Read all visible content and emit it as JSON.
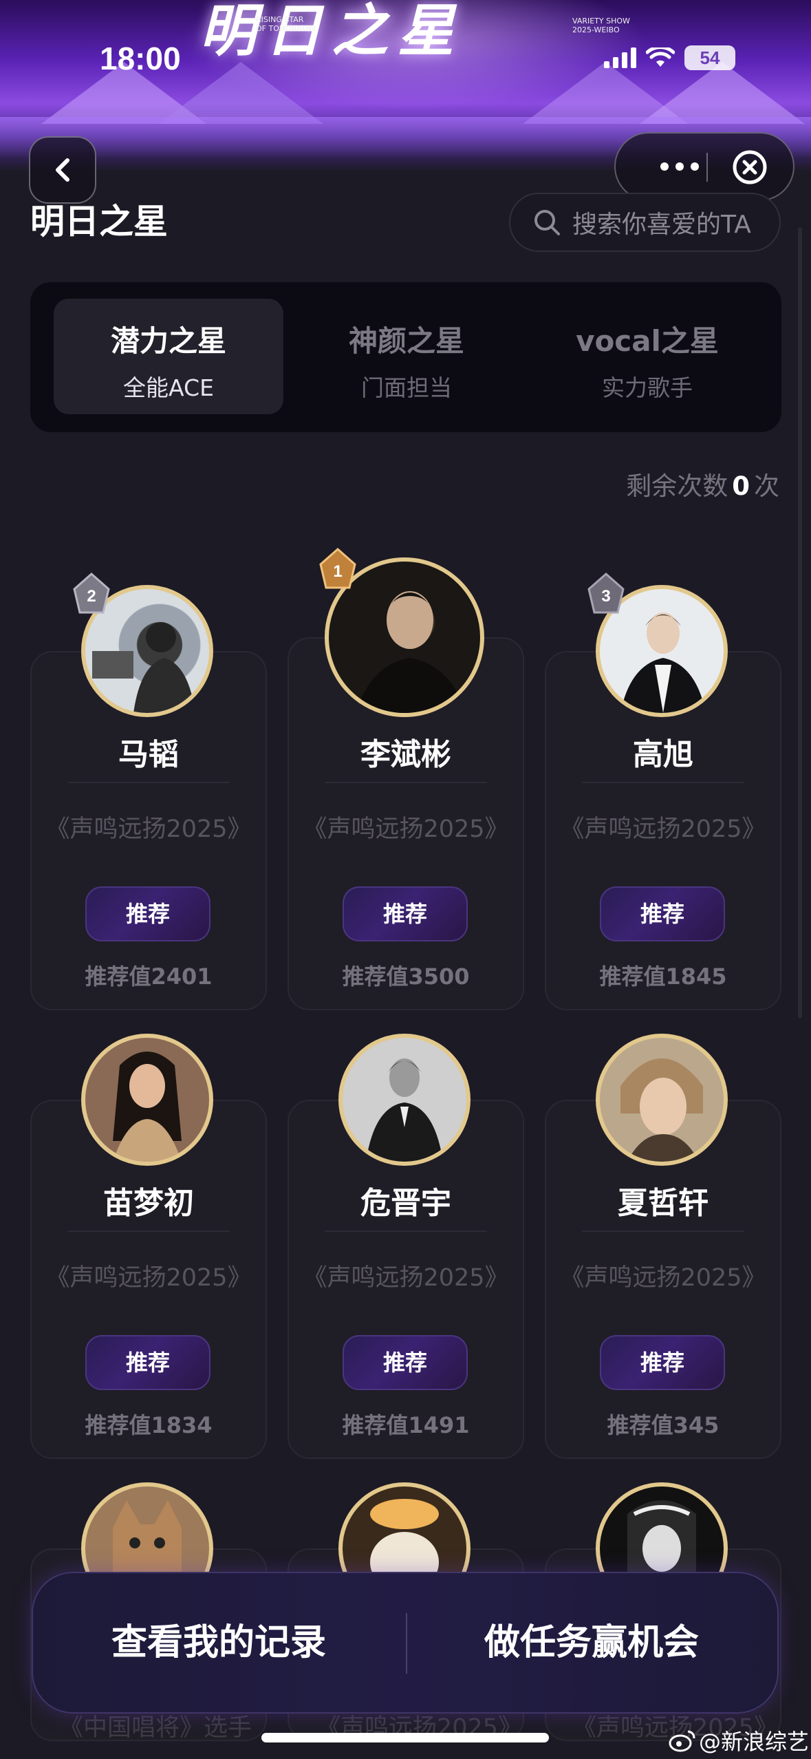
{
  "status_bar": {
    "time": "18:00",
    "battery": "54"
  },
  "banner": {
    "logo_text": "明日之星",
    "sub_left": [
      "RISING STAR",
      "OF TOMORROW"
    ],
    "sub_right": [
      "VARIETY SHOW",
      "2025-WEIBO"
    ]
  },
  "header": {
    "title": "明日之星",
    "search_placeholder": "搜索你喜爱的TA"
  },
  "tabs": [
    {
      "title": "潜力之星",
      "subtitle": "全能ACE",
      "active": true
    },
    {
      "title": "神颜之星",
      "subtitle": "门面担当",
      "active": false
    },
    {
      "title": "vocal之星",
      "subtitle": "实力歌手",
      "active": false
    }
  ],
  "remaining": {
    "prefix": "剩余次数",
    "count": "0",
    "suffix": "次"
  },
  "candidates": [
    {
      "name": "马韬",
      "show": "《声鸣远扬2025》",
      "button": "推荐",
      "score": "推荐值2401",
      "rank": "2"
    },
    {
      "name": "李斌彬",
      "show": "《声鸣远扬2025》",
      "button": "推荐",
      "score": "推荐值3500",
      "rank": "1"
    },
    {
      "name": "高旭",
      "show": "《声鸣远扬2025》",
      "button": "推荐",
      "score": "推荐值1845",
      "rank": "3"
    },
    {
      "name": "苗梦初",
      "show": "《声鸣远扬2025》",
      "button": "推荐",
      "score": "推荐值1834"
    },
    {
      "name": "危晋宇",
      "show": "《声鸣远扬2025》",
      "button": "推荐",
      "score": "推荐值1491"
    },
    {
      "name": "夏哲轩",
      "show": "《声鸣远扬2025》",
      "button": "推荐",
      "score": "推荐值345"
    }
  ],
  "partial_row": [
    "《中国唱将》选手",
    "《声鸣远扬2025》",
    "《声鸣远扬2025》"
  ],
  "bottom_bar": {
    "left": "查看我的记录",
    "right": "做任务赢机会"
  },
  "watermark": "@新浪综艺",
  "colors": {
    "accent_gold": "#e2c88c",
    "bg": "#1c1a24",
    "button_purple": "#3b2272"
  }
}
